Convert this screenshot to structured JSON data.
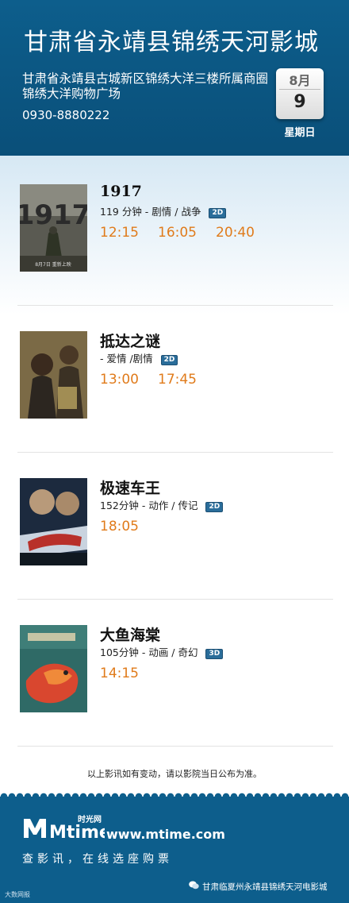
{
  "cinema": {
    "name": "甘肃省永靖县锦绣天河影城",
    "address": "甘肃省永靖县古城新区锦绣大洋三楼所属商圈锦绣大洋购物广场",
    "phone": "0930-8880222"
  },
  "date": {
    "month": "8月",
    "day": "9",
    "weekday": "星期日"
  },
  "movies": [
    {
      "title": "1917",
      "info": "119 分钟 - 剧情 / 战争",
      "format": "2D",
      "times": [
        "12:15",
        "16:05",
        "20:40"
      ]
    },
    {
      "title": "抵达之谜",
      "info": "- 爱情 /剧情",
      "format": "2D",
      "times": [
        "13:00",
        "17:45"
      ]
    },
    {
      "title": "极速车王",
      "info": "152分钟 - 动作 / 传记",
      "format": "2D",
      "times": [
        "18:05"
      ]
    },
    {
      "title": "大鱼海棠",
      "info": "105分钟 - 动画 / 奇幻",
      "format": "3D",
      "times": [
        "14:15"
      ]
    }
  ],
  "notice": "以上影讯如有变动，请以影院当日公布为准。",
  "footer": {
    "logo_cn": "时光网",
    "logo_en": "Mtime",
    "website": "www.mtime.com",
    "slogan": "查影讯，在线选座购票",
    "wechat_label": "甘肃临夏州永靖县锦绣天河电影城",
    "credit": "大数网报"
  },
  "colors": {
    "header_bg": "#0d5e8c",
    "showtime": "#e07b1b",
    "badge": "#2a6d9a"
  }
}
